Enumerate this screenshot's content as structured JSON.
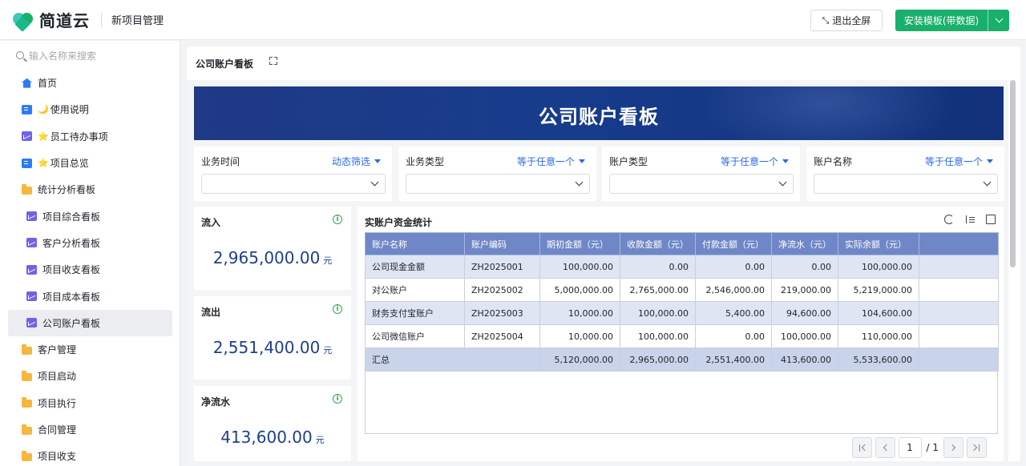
{
  "brand": {
    "name": "简道云"
  },
  "app": {
    "title": "新项目管理"
  },
  "toolbar": {
    "exit_fullscreen": "退出全屏",
    "install_template": "安装模板(带数据)"
  },
  "sidebar": {
    "search_placeholder": "输入名称来搜索",
    "items": [
      {
        "label": "首页",
        "icon": "home-icon"
      },
      {
        "label": "使用说明",
        "prefix": "🌙",
        "icon": "form-icon"
      },
      {
        "label": "员工待办事项",
        "prefix": "⭐",
        "icon": "dashboard-icon"
      },
      {
        "label": "项目总览",
        "prefix": "⭐",
        "icon": "form-icon"
      },
      {
        "label": "统计分析看板",
        "icon": "folder-icon"
      },
      {
        "label": "项目综合看板",
        "icon": "dashboard-icon"
      },
      {
        "label": "客户分析看板",
        "icon": "dashboard-icon"
      },
      {
        "label": "项目收支看板",
        "icon": "dashboard-icon"
      },
      {
        "label": "项目成本看板",
        "icon": "dashboard-icon"
      },
      {
        "label": "公司账户看板",
        "icon": "dashboard-icon",
        "active": true
      },
      {
        "label": "客户管理",
        "icon": "folder-icon"
      },
      {
        "label": "项目启动",
        "icon": "folder-icon"
      },
      {
        "label": "项目执行",
        "icon": "folder-icon"
      },
      {
        "label": "合同管理",
        "icon": "folder-icon"
      },
      {
        "label": "项目收支",
        "icon": "folder-icon"
      }
    ]
  },
  "page": {
    "title": "公司账户看板",
    "banner_title": "公司账户看板"
  },
  "filters": [
    {
      "label": "业务时间",
      "operator": "动态筛选"
    },
    {
      "label": "业务类型",
      "operator": "等于任意一个"
    },
    {
      "label": "账户类型",
      "operator": "等于任意一个"
    },
    {
      "label": "账户名称",
      "operator": "等于任意一个"
    }
  ],
  "stats": [
    {
      "label": "流入",
      "value": "2,965,000.00",
      "unit": "元"
    },
    {
      "label": "流出",
      "value": "2,551,400.00",
      "unit": "元"
    },
    {
      "label": "净流水",
      "value": "413,600.00",
      "unit": "元"
    }
  ],
  "table": {
    "title": "实账户资金统计",
    "columns": [
      "账户名称",
      "账户编码",
      "期初金额（元）",
      "收款金额（元）",
      "付款金额（元）",
      "净流水（元）",
      "实际余额（元）"
    ],
    "rows": [
      [
        "公司现金金额",
        "ZH2025001",
        "100,000.00",
        "0.00",
        "0.00",
        "0.00",
        "100,000.00"
      ],
      [
        "对公账户",
        "ZH2025002",
        "5,000,000.00",
        "2,765,000.00",
        "2,546,000.00",
        "219,000.00",
        "5,219,000.00"
      ],
      [
        "财务支付宝账户",
        "ZH2025003",
        "10,000.00",
        "100,000.00",
        "5,400.00",
        "94,600.00",
        "104,600.00"
      ],
      [
        "公司微信账户",
        "ZH2025004",
        "10,000.00",
        "100,000.00",
        "0.00",
        "100,000.00",
        "110,000.00"
      ]
    ],
    "total": {
      "label": "汇总",
      "values": [
        "5,120,000.00",
        "2,965,000.00",
        "2,551,400.00",
        "413,600.00",
        "5,533,600.00"
      ]
    },
    "pagination": {
      "current": "1",
      "total": "/ 1"
    }
  },
  "colors": {
    "accent": "#18b06a",
    "banner": "#173c8c",
    "header": "#6f87c6",
    "value": "#1e3f8a",
    "link": "#2a6ae9"
  }
}
